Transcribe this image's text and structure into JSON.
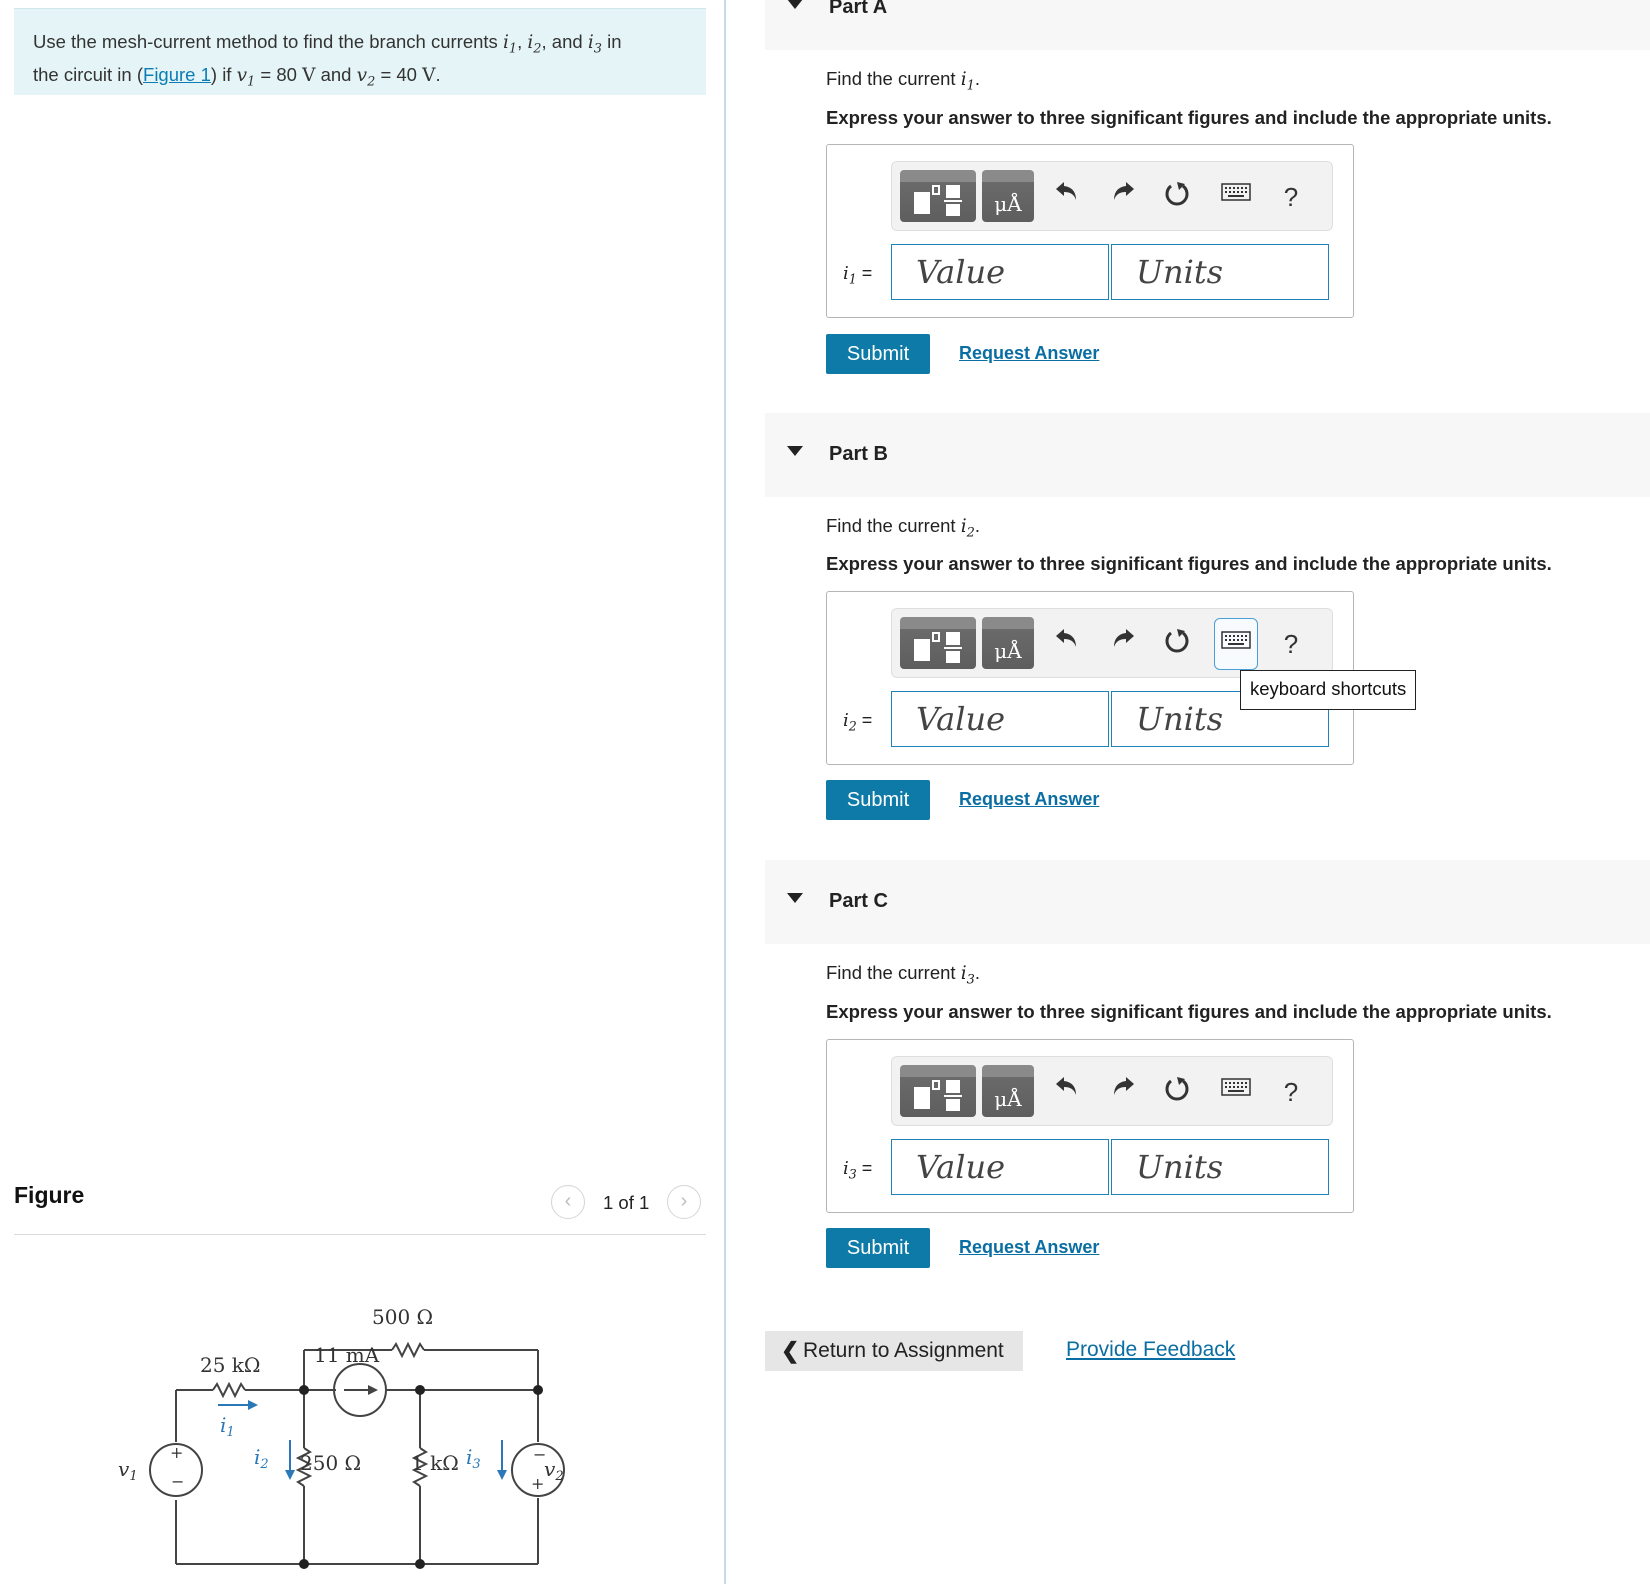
{
  "problem": {
    "text_1": "Use the mesh-current method to find the branch currents ",
    "i1": "i",
    "sep_1": ", ",
    "sep_2": ", and ",
    "text_2": " in",
    "text_3": "the circuit in (",
    "figure_link": "Figure 1",
    "text_4": ") if ",
    "v1_eq": " = 80 ",
    "unit_v": "V",
    "and": " and ",
    "v2_eq": " = 40 ",
    "end": "."
  },
  "figure": {
    "title": "Figure",
    "page": "1 of 1",
    "prev_icon": "chevron-left-icon",
    "next_icon": "chevron-right-icon",
    "labels": {
      "r500": "500 Ω",
      "r25k": "25 kΩ",
      "cs": "11 mA",
      "r250": "250 Ω",
      "r1k": "1 kΩ",
      "v1": "v",
      "v2": "v",
      "i1": "i",
      "i2": "i",
      "i3": "i",
      "plus": "+",
      "minus": "−"
    }
  },
  "parts": [
    {
      "title": "Part A",
      "find": "Find the current ",
      "var_sub": "1",
      "instructions": "Express your answer to three significant figures and include the appropriate units.",
      "label": " =",
      "value_placeholder": "Value",
      "units_placeholder": "Units",
      "submit": "Submit",
      "request": "Request Answer"
    },
    {
      "title": "Part B",
      "find": "Find the current ",
      "var_sub": "2",
      "instructions": "Express your answer to three significant figures and include the appropriate units.",
      "label": " =",
      "value_placeholder": "Value",
      "units_placeholder": "Units",
      "submit": "Submit",
      "request": "Request Answer"
    },
    {
      "title": "Part C",
      "find": "Find the current ",
      "var_sub": "3",
      "instructions": "Express your answer to three significant figures and include the appropriate units.",
      "label": " =",
      "value_placeholder": "Value",
      "units_placeholder": "Units",
      "submit": "Submit",
      "request": "Request Answer"
    }
  ],
  "toolbar": {
    "units_glyph": "μÅ",
    "undo_icon": "undo-icon",
    "redo_icon": "redo-icon",
    "reset_icon": "reset-icon",
    "keyboard_icon": "keyboard-icon",
    "help": "?"
  },
  "tooltip": "keyboard shortcuts",
  "footer": {
    "return": "Return to Assignment",
    "feedback": "Provide Feedback"
  },
  "colors": {
    "accent": "#0e7aa8",
    "link": "#0a6ea3",
    "problem_bg": "#e5f5f7"
  }
}
